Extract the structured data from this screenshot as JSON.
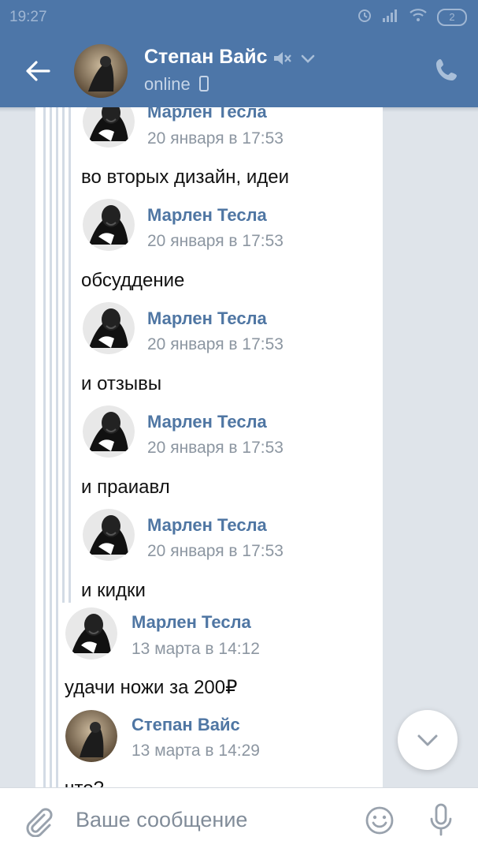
{
  "statusbar": {
    "time": "19:27",
    "battery": "2"
  },
  "header": {
    "name": "Степан Вайс",
    "status": "online"
  },
  "messages": [
    {
      "sender": "Марлен Тесла",
      "date": "20 января в 17:53",
      "text": "во вторых дизайн, идеи"
    },
    {
      "sender": "Марлен Тесла",
      "date": "20 января в 17:53",
      "text": "обсуддение"
    },
    {
      "sender": "Марлен Тесла",
      "date": "20 января в 17:53",
      "text": "и отзывы"
    },
    {
      "sender": "Марлен Тесла",
      "date": "20 января в 17:53",
      "text": "и праиавл"
    },
    {
      "sender": "Марлен Тесла",
      "date": "20 января в 17:53",
      "text": "и кидки"
    },
    {
      "sender": "Марлен Тесла",
      "date": "13 марта в 14:12",
      "text": "удачи ножи за 200₽"
    },
    {
      "sender": "Степан Вайс",
      "date": "13 марта в 14:29",
      "text": "что?"
    }
  ],
  "composer": {
    "placeholder": "Ваше сообщение"
  },
  "icons": {
    "back": "arrow-left-icon",
    "muted": "speaker-muted-icon",
    "chevron": "chevron-down-icon",
    "device": "mobile-device-icon",
    "call": "phone-icon",
    "scroll": "chevron-down-icon",
    "attach": "paperclip-icon",
    "emoji": "smiley-icon",
    "mic": "microphone-icon"
  },
  "colors": {
    "header": "#4d76a8",
    "sender": "#4f76a3",
    "date": "#8c96a1",
    "background": "#dfe4ea"
  }
}
